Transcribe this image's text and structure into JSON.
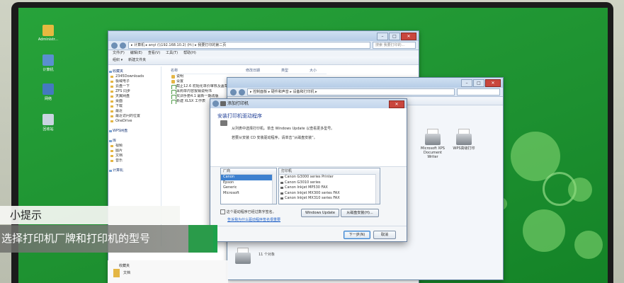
{
  "desktop_icons": [
    {
      "label": "Administr...",
      "icon": "user-folder-icon"
    },
    {
      "label": "计算机",
      "icon": "computer-icon"
    },
    {
      "label": "网络",
      "icon": "network-icon"
    },
    {
      "label": "回收站",
      "icon": "recycle-bin-icon"
    }
  ],
  "explorer": {
    "address": "▸ 计算机 ▸ anyi (\\\\192.168.10.2) (H:) ▸ 我要打印的第二页",
    "search_placeholder": "搜索 我要打印的...",
    "menu": [
      "文件(F)",
      "编辑(E)",
      "查看(V)",
      "工具(T)",
      "帮助(H)"
    ],
    "toolbar": [
      "组织 ▾",
      "新建文件夹"
    ],
    "sidebar": [
      {
        "label": "收藏夹",
        "head": true
      },
      {
        "label": "2345Downloads",
        "head": false
      },
      {
        "label": "极域电子",
        "head": false
      },
      {
        "label": "云盘一下",
        "head": false
      },
      {
        "label": "ZFS 同步",
        "head": false
      },
      {
        "label": "天翼网盘",
        "head": false
      },
      {
        "label": "桌面",
        "head": false
      },
      {
        "label": "下载",
        "head": false
      },
      {
        "label": "最近",
        "head": false
      },
      {
        "label": "最近访问的位置",
        "head": false
      },
      {
        "label": "OneDrive",
        "head": false
      },
      {
        "label": "WPS网盘",
        "head": true
      },
      {
        "label": "库",
        "head": true
      },
      {
        "label": "视频",
        "head": false
      },
      {
        "label": "图片",
        "head": false
      },
      {
        "label": "文档",
        "head": false
      },
      {
        "label": "音乐",
        "head": false
      },
      {
        "label": "计算机",
        "head": true
      }
    ],
    "columns": [
      "名称",
      "修改日期",
      "类型",
      "大小"
    ],
    "files": [
      {
        "name": "说明",
        "dir": true
      },
      {
        "name": "设置",
        "dir": true
      },
      {
        "name": "截止12.6 初始化单价审核及盖章",
        "dir": false
      },
      {
        "name": "采购单内容报销说明书",
        "dir": false
      },
      {
        "name": "实训手册4.1 最新一期改版",
        "dir": false
      },
      {
        "name": "新建 XLSX 工作表",
        "dir": false
      }
    ],
    "status": "12 个对象",
    "bottom_folder": "收藏夹",
    "bottom_sub": "文档"
  },
  "printers_window": {
    "address": "▸ 控制面板 ▸ 硬件和声音 ▸ 设备和打印机 ▸",
    "printers": [
      {
        "label": "Microsoft XPS Document Writer"
      },
      {
        "label": "WPS高级打印"
      }
    ],
    "status": "11 个对象"
  },
  "dialog": {
    "title": "添加打印机",
    "heading": "安装打印机驱动程序",
    "line1": "从列表中选择打印机。单击 Windows Update 以查看更多型号。",
    "line2": "若要从安装 CD 安装驱动程序，请单击“从磁盘安装”。",
    "manufacturer_header": "厂商",
    "manufacturers": [
      "Canon",
      "Epson",
      "Generic",
      "Microsoft"
    ],
    "manufacturer_selected": 0,
    "printers_header": "打印机",
    "printers": [
      "Canon G3000 series Printer",
      "Canon G3010 series",
      "Canon Inkjet MP530 FAX",
      "Canon Inkjet MX300 series FAX",
      "Canon Inkjet MX310 series FAX"
    ],
    "signed_note": "这个驱动程序已经过数字签名。",
    "signing_link": "告诉我为什么驱动程序签名很重要",
    "windows_update": "Windows Update",
    "have_disk": "从磁盘安装(H)...",
    "next": "下一步(N)",
    "cancel": "取消"
  },
  "tip": {
    "title": "小提示",
    "body": "选择打印机厂牌和打印机的型号"
  },
  "colors": {
    "desktop": "#1d9030",
    "selection": "#3d80cf",
    "link": "#1e3e96",
    "close": "#c9463d"
  }
}
